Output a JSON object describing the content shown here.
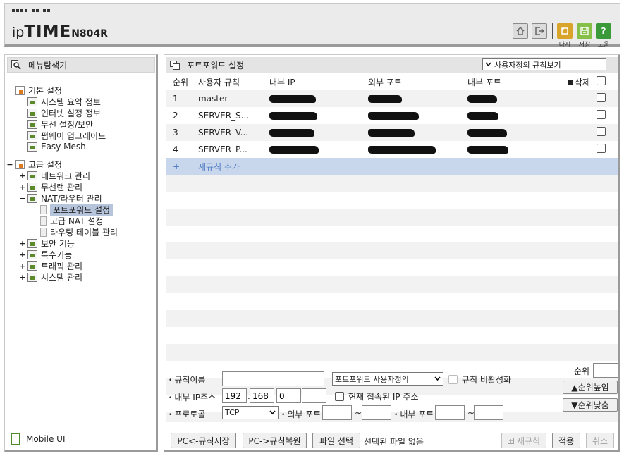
{
  "header": {
    "logo_ip": "ip",
    "logo_time": "TIME",
    "logo_model": "N804R",
    "buttons": {
      "retry_label": "다시",
      "save_label": "저장",
      "help_label": "도움"
    },
    "icons": {
      "home": "home-icon",
      "logout": "logout-icon",
      "retry": "retry-icon",
      "save": "save-icon",
      "help": "help-icon"
    }
  },
  "sidebar": {
    "title": "메뉴탐색기",
    "basic": {
      "label": "기본 설정",
      "items": [
        "시스템 요약 정보",
        "인터넷 설정 정보",
        "무선 설정/보안",
        "펌웨어 업그레이드",
        "Easy Mesh"
      ]
    },
    "advanced": {
      "label": "고급 설정",
      "items": {
        "network": "네트워크 관리",
        "wireless": "무선랜 관리",
        "nat": "NAT/라우터 관리",
        "nat_children": [
          "포트포워드 설정",
          "고급 NAT 설정",
          "라우팅 테이블 관리"
        ],
        "security": "보안 기능",
        "special": "특수기능",
        "traffic": "트래픽 관리",
        "system": "시스템 관리"
      }
    },
    "mobile_ui": "Mobile UI",
    "exp_minus": "−",
    "exp_plus": "+"
  },
  "main": {
    "title": "포트포워드 설정",
    "view_select": "사용자정의 규칙보기",
    "columns": {
      "no": "순위",
      "rule": "사용자 규칙",
      "inner_ip": "내부 IP",
      "outer_port": "외부 포트",
      "inner_port": "내부 포트",
      "delete": "삭제"
    },
    "rows": [
      {
        "no": "1",
        "rule": "master"
      },
      {
        "no": "2",
        "rule": "SERVER_S..."
      },
      {
        "no": "3",
        "rule": "SERVER_V..."
      },
      {
        "no": "4",
        "rule": "SERVER_P..."
      }
    ],
    "add_rule": "새규칙 추가",
    "add_icon": "+"
  },
  "form": {
    "rule_name_label": "규칙이름",
    "rule_name_value": "",
    "rule_type_select": "포트포워드 사용자정의",
    "disable_rule_label": "규칙 비활성화",
    "inner_ip_label": "내부 IP주소",
    "ip_1": "192",
    "ip_2": "168",
    "ip_3": "0",
    "ip_4": "",
    "current_ip_label": "현재 접속된 IP 주소",
    "protocol_label": "프로토콜",
    "protocol_value": "TCP",
    "outer_port_label": "외부 포트",
    "inner_port_label": "내부 포트",
    "tilde": "~",
    "priority_label": "순위",
    "priority_value": "",
    "priority_up": "▲순위높임",
    "priority_down": "▼순위낮춤"
  },
  "bottom": {
    "pc_save": "PC<-규칙저장",
    "pc_restore": "PC->규칙복원",
    "file_select": "파일 선택",
    "file_status": "선택된 파일 없음",
    "new_rule": "새규칙",
    "apply": "적용",
    "cancel": "취소"
  }
}
